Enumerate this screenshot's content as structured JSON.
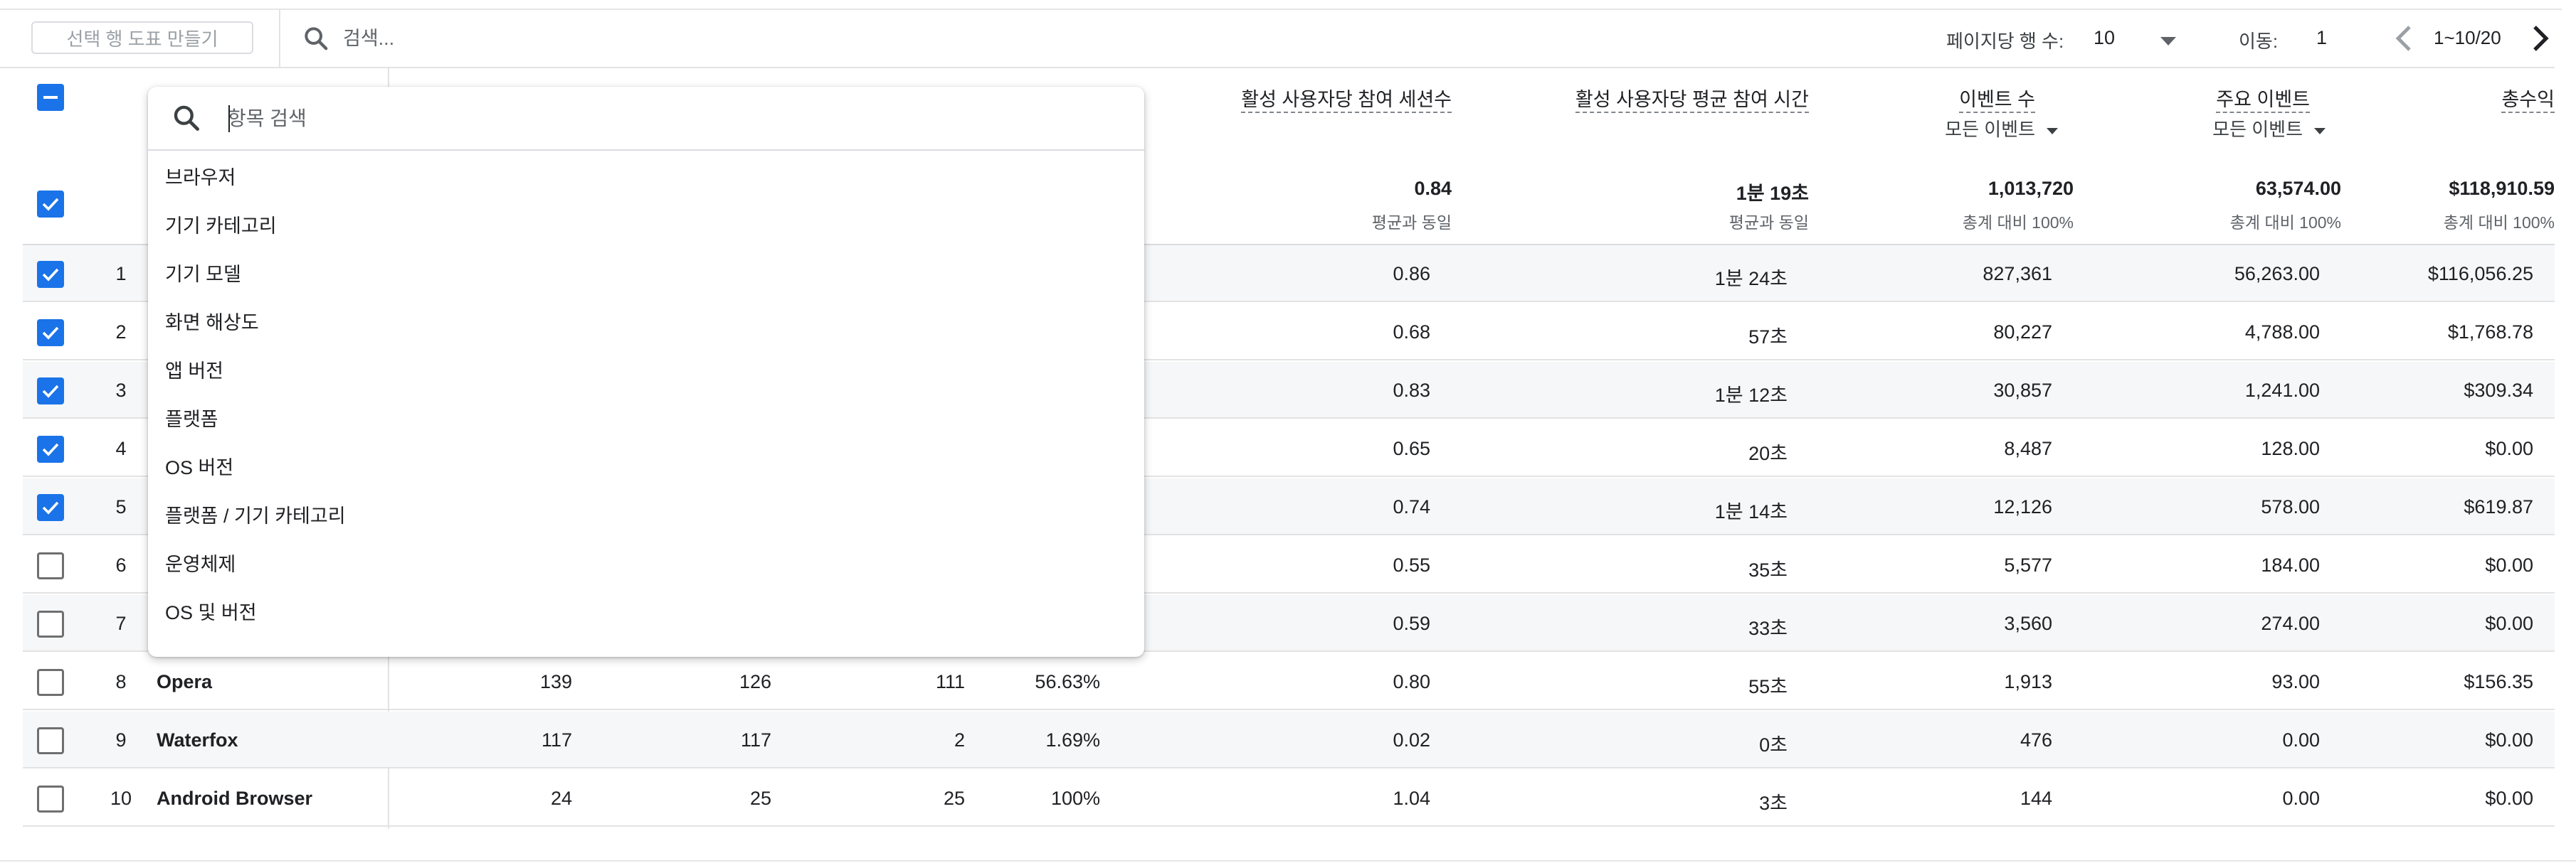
{
  "toolbar": {
    "plot_rows_label": "선택 행 도표 만들기",
    "search_placeholder": "검색...",
    "rows_per_page_label": "페이지당 행 수:",
    "rows_per_page_value": "10",
    "goto_label": "이동:",
    "goto_value": "1",
    "range": "1~10/20"
  },
  "headers": {
    "sessions_per_user": "활성 사용자당 참여 세션수",
    "avg_engagement_time": "활성 사용자당 평균 참여 시간",
    "event_count": "이벤트 수",
    "event_count_filter": "모든 이벤트",
    "key_events": "주요 이벤트",
    "key_events_filter": "모든 이벤트",
    "total_revenue": "총수익"
  },
  "totals": {
    "sessions_per_user": "0.84",
    "sessions_per_user_sub": "평균과 동일",
    "avg_engagement_time": "1분 19초",
    "avg_engagement_time_sub": "평균과 동일",
    "event_count": "1,013,720",
    "event_count_sub": "총계 대비 100%",
    "key_events": "63,574.00",
    "key_events_sub": "총계 대비 100%",
    "total_revenue": "$118,910.59",
    "total_revenue_sub": "총계 대비 100%"
  },
  "rows": [
    {
      "idx": "1",
      "name": "",
      "c1": "",
      "c2": "",
      "c3": "",
      "c4": "",
      "sessions": "0.86",
      "time": "1분 24초",
      "events": "827,361",
      "key": "56,263.00",
      "revenue": "$116,056.25"
    },
    {
      "idx": "2",
      "name": "",
      "c1": "",
      "c2": "",
      "c3": "",
      "c4": "",
      "sessions": "0.68",
      "time": "57초",
      "events": "80,227",
      "key": "4,788.00",
      "revenue": "$1,768.78"
    },
    {
      "idx": "3",
      "name": "",
      "c1": "",
      "c2": "",
      "c3": "",
      "c4": "",
      "sessions": "0.83",
      "time": "1분 12초",
      "events": "30,857",
      "key": "1,241.00",
      "revenue": "$309.34"
    },
    {
      "idx": "4",
      "name": "",
      "c1": "",
      "c2": "",
      "c3": "",
      "c4": "",
      "sessions": "0.65",
      "time": "20초",
      "events": "8,487",
      "key": "128.00",
      "revenue": "$0.00"
    },
    {
      "idx": "5",
      "name": "",
      "c1": "",
      "c2": "",
      "c3": "",
      "c4": "",
      "sessions": "0.74",
      "time": "1분 14초",
      "events": "12,126",
      "key": "578.00",
      "revenue": "$619.87"
    },
    {
      "idx": "6",
      "name": "",
      "c1": "",
      "c2": "",
      "c3": "",
      "c4": "",
      "sessions": "0.55",
      "time": "35초",
      "events": "5,577",
      "key": "184.00",
      "revenue": "$0.00"
    },
    {
      "idx": "7",
      "name": "",
      "c1": "",
      "c2": "",
      "c3": "",
      "c4": "",
      "sessions": "0.59",
      "time": "33초",
      "events": "3,560",
      "key": "274.00",
      "revenue": "$0.00"
    },
    {
      "idx": "8",
      "name": "Opera",
      "c1": "139",
      "c2": "126",
      "c3": "111",
      "c4": "56.63%",
      "sessions": "0.80",
      "time": "55초",
      "events": "1,913",
      "key": "93.00",
      "revenue": "$156.35"
    },
    {
      "idx": "9",
      "name": "Waterfox",
      "c1": "117",
      "c2": "117",
      "c3": "2",
      "c4": "1.69%",
      "sessions": "0.02",
      "time": "0초",
      "events": "476",
      "key": "0.00",
      "revenue": "$0.00"
    },
    {
      "idx": "10",
      "name": "Android Browser",
      "c1": "24",
      "c2": "25",
      "c3": "25",
      "c4": "100%",
      "sessions": "1.04",
      "time": "3초",
      "events": "144",
      "key": "0.00",
      "revenue": "$0.00"
    }
  ],
  "selection": {
    "header_checkbox": "indeterminate",
    "totals_checkbox": "checked",
    "row_checked": [
      true,
      true,
      true,
      true,
      true,
      false,
      false,
      false,
      false,
      false
    ]
  },
  "dimension_picker": {
    "search_placeholder": "항목 검색",
    "options": [
      "브라우저",
      "기기 카테고리",
      "기기 모델",
      "화면 해상도",
      "앱 버전",
      "플랫폼",
      "OS 버전",
      "플랫폼 / 기기 카테고리",
      "운영체제",
      "OS 및 버전"
    ]
  },
  "colors": {
    "accent": "#1a73e8",
    "row_shade": "#f6f7f9",
    "border": "#e3e3e3"
  }
}
